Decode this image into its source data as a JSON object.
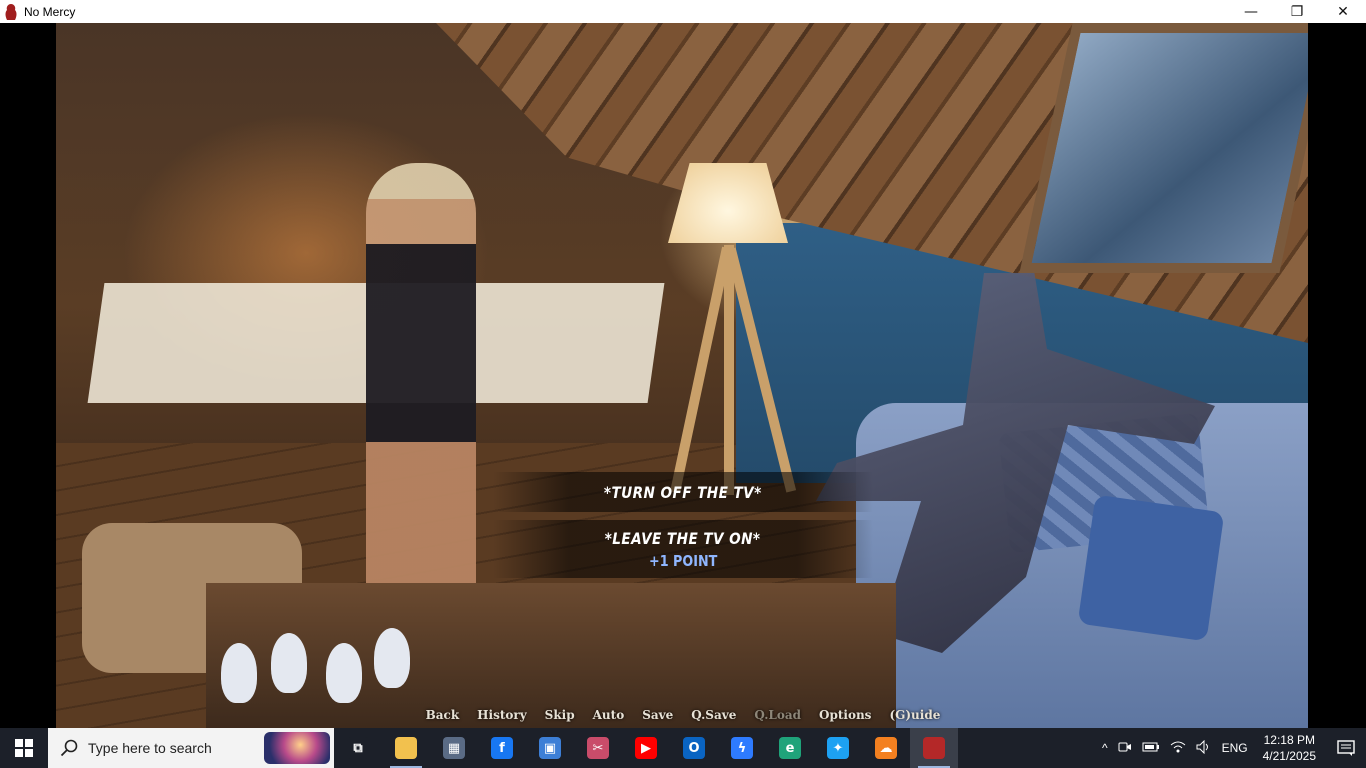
{
  "window": {
    "title": "No Mercy",
    "minimize": "—",
    "maximize": "❐",
    "close": "✕"
  },
  "game": {
    "choices": [
      {
        "text": "*TURN OFF THE TV*",
        "points": ""
      },
      {
        "text": "*LEAVE THE TV ON*",
        "points": "+1 POINT"
      }
    ],
    "quick_menu": [
      {
        "label": "Back",
        "enabled": true
      },
      {
        "label": "History",
        "enabled": true
      },
      {
        "label": "Skip",
        "enabled": true
      },
      {
        "label": "Auto",
        "enabled": true
      },
      {
        "label": "Save",
        "enabled": true
      },
      {
        "label": "Q.Save",
        "enabled": true
      },
      {
        "label": "Q.Load",
        "enabled": false
      },
      {
        "label": "Options",
        "enabled": true
      },
      {
        "label": "(G)uide",
        "enabled": true
      }
    ]
  },
  "taskbar": {
    "search_placeholder": "Type here to search",
    "apps": [
      {
        "name": "task-view-icon",
        "glyph": "⧉",
        "color": "#1c2029",
        "active": false
      },
      {
        "name": "file-explorer-icon",
        "glyph": "",
        "color": "#f2c14e",
        "active": true
      },
      {
        "name": "calculator-icon",
        "glyph": "▦",
        "color": "#5a6b85",
        "active": false
      },
      {
        "name": "facebook-icon",
        "glyph": "f",
        "color": "#1877f2",
        "active": false
      },
      {
        "name": "control-panel-icon",
        "glyph": "▣",
        "color": "#3d7fd6",
        "active": false
      },
      {
        "name": "snipping-tool-icon",
        "glyph": "✂",
        "color": "#c94c6a",
        "active": false
      },
      {
        "name": "youtube-icon",
        "glyph": "▶",
        "color": "#ff0000",
        "active": false
      },
      {
        "name": "outlook-icon",
        "glyph": "O",
        "color": "#0a64c2",
        "active": false
      },
      {
        "name": "messenger-icon",
        "glyph": "ϟ",
        "color": "#2e7bff",
        "active": false
      },
      {
        "name": "edge-icon",
        "glyph": "e",
        "color": "#1fa37a",
        "active": false
      },
      {
        "name": "twitter-icon",
        "glyph": "✦",
        "color": "#1da1f2",
        "active": false
      },
      {
        "name": "cloudflare-icon",
        "glyph": "☁",
        "color": "#f38020",
        "active": false
      },
      {
        "name": "no-mercy-game-icon",
        "glyph": "",
        "color": "#b42828",
        "active": true
      }
    ],
    "tray": {
      "chevron": "^",
      "language": "ENG",
      "time": "12:18 PM",
      "date": "4/21/2025"
    }
  }
}
